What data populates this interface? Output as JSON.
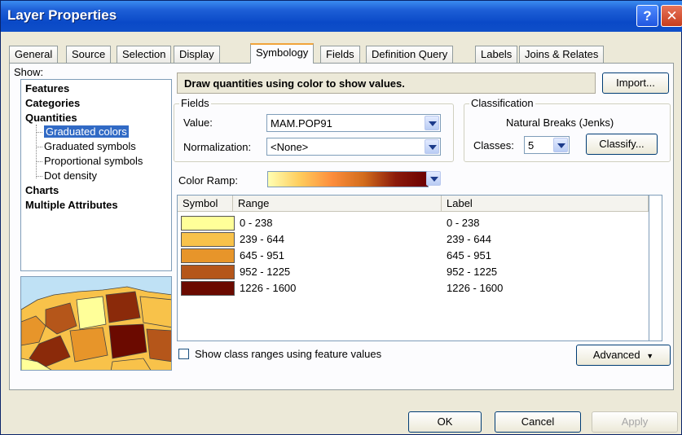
{
  "window": {
    "title": "Layer Properties"
  },
  "tabs": [
    {
      "label": "General"
    },
    {
      "label": "Source"
    },
    {
      "label": "Selection"
    },
    {
      "label": "Display"
    },
    {
      "label": "Symbology"
    },
    {
      "label": "Fields"
    },
    {
      "label": "Definition Query"
    },
    {
      "label": "Labels"
    },
    {
      "label": "Joins & Relates"
    }
  ],
  "show": {
    "label": "Show:",
    "items": [
      {
        "label": "Features"
      },
      {
        "label": "Categories"
      },
      {
        "label": "Quantities"
      },
      {
        "label": "Graduated colors"
      },
      {
        "label": "Graduated symbols"
      },
      {
        "label": "Proportional symbols"
      },
      {
        "label": "Dot density"
      },
      {
        "label": "Charts"
      },
      {
        "label": "Multiple Attributes"
      }
    ],
    "selected": "Graduated colors"
  },
  "description": "Draw quantities using color to show values.",
  "import_label": "Import...",
  "fields": {
    "title": "Fields",
    "value_label": "Value:",
    "value": "MAM.POP91",
    "normalization_label": "Normalization:",
    "normalization": "<None>"
  },
  "classification": {
    "title": "Classification",
    "method": "Natural Breaks (Jenks)",
    "classes_label": "Classes:",
    "classes": "5",
    "classify_label": "Classify..."
  },
  "color_ramp": {
    "label": "Color Ramp:",
    "colors": [
      "#ffffb2",
      "#fecc5c",
      "#fd8d3c",
      "#d26c1c",
      "#8b1a0b",
      "#6b0000"
    ]
  },
  "table": {
    "headers": {
      "symbol": "Symbol",
      "range": "Range",
      "label": "Label"
    },
    "rows": [
      {
        "color": "#ffff99",
        "range": "0 - 238",
        "label": "0 - 238"
      },
      {
        "color": "#f8c24a",
        "range": "239 - 644",
        "label": "239 - 644"
      },
      {
        "color": "#e7952a",
        "range": "645 - 951",
        "label": "645 - 951"
      },
      {
        "color": "#b5561a",
        "range": "952 - 1225",
        "label": "952 - 1225"
      },
      {
        "color": "#6b0a00",
        "range": "1226 - 1600",
        "label": "1226 - 1600"
      }
    ]
  },
  "checkbox_label": "Show class ranges using feature values",
  "advanced_label": "Advanced",
  "buttons": {
    "ok": "OK",
    "cancel": "Cancel",
    "apply": "Apply"
  }
}
